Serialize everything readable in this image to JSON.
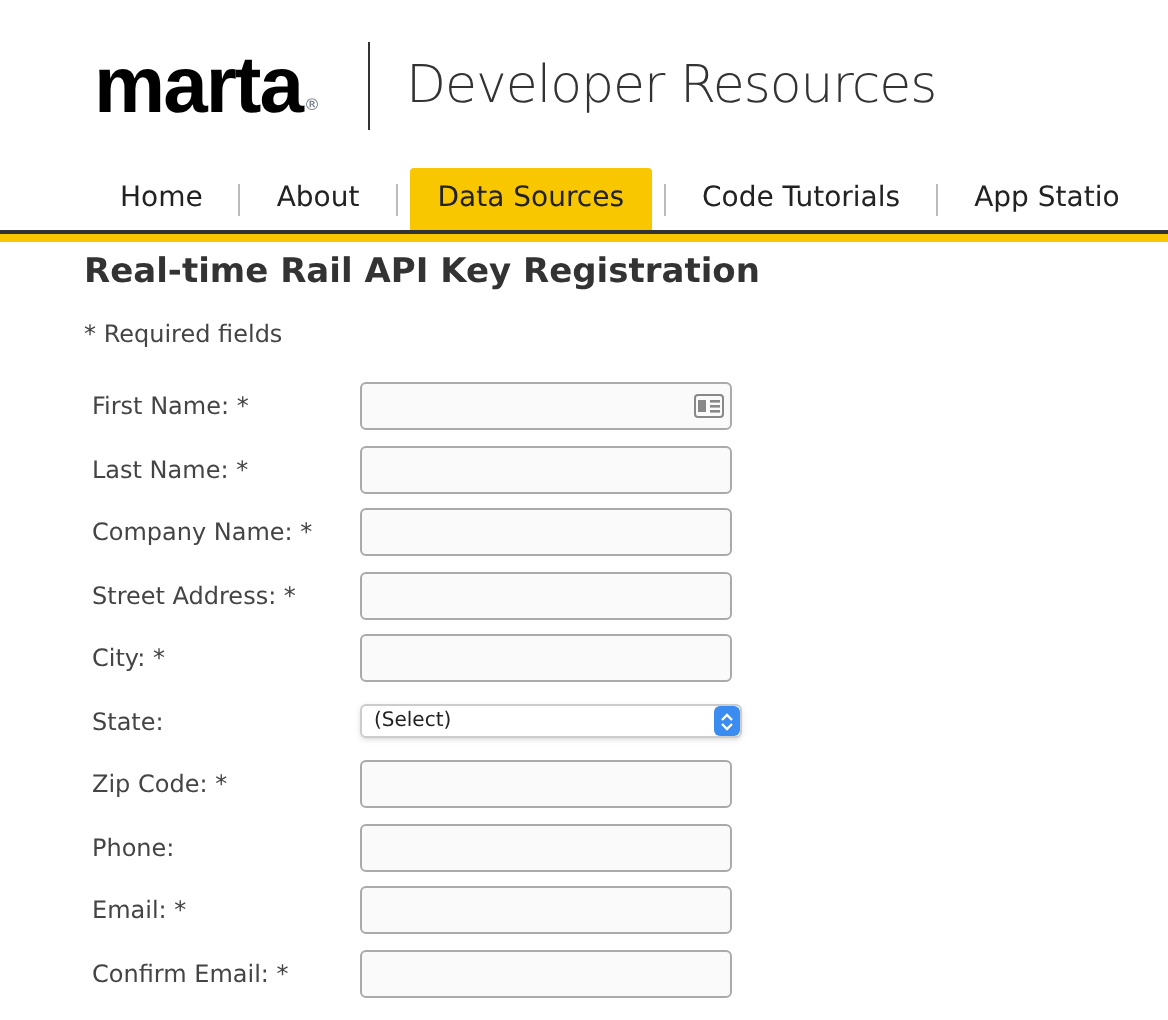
{
  "header": {
    "logo": "marta",
    "logo_mark": "®",
    "title": "Developer Resources"
  },
  "nav": [
    {
      "label": "Home",
      "selected": false
    },
    {
      "label": "About",
      "selected": false
    },
    {
      "label": "Data Sources",
      "selected": true
    },
    {
      "label": "Code Tutorials",
      "selected": false
    },
    {
      "label": "App Statio",
      "selected": false
    }
  ],
  "heading": "Real-time Rail API Key Registration",
  "required_note": "* Required fields",
  "fields": [
    {
      "label": "First Name: *",
      "kind": "text",
      "autofill": true
    },
    {
      "label": "Last Name: *",
      "kind": "text",
      "autofill": false
    },
    {
      "label": "Company Name: *",
      "kind": "text",
      "autofill": false
    },
    {
      "label": "Street Address: *",
      "kind": "text",
      "autofill": false
    },
    {
      "label": "City: *",
      "kind": "text",
      "autofill": false
    },
    {
      "label": "State:",
      "kind": "select",
      "value": "(Select)"
    },
    {
      "label": "Zip Code: *",
      "kind": "text",
      "autofill": false
    },
    {
      "label": "Phone:",
      "kind": "text",
      "autofill": false
    },
    {
      "label": "Email: *",
      "kind": "text",
      "autofill": false
    },
    {
      "label": "Confirm Email: *",
      "kind": "text",
      "autofill": false
    }
  ]
}
